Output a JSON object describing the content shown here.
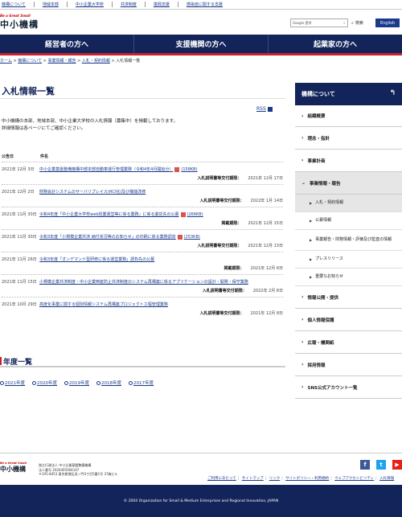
{
  "top_links": [
    "機構について",
    "地域本部",
    "中小企業大学校",
    "共済制度",
    "復興支援",
    "感染症に関する支援"
  ],
  "header": {
    "logo_tag": "Be a Great Small",
    "logo_name": "中小機構",
    "search_label": "Google 提供",
    "search_button": "検索",
    "lang_button": "English"
  },
  "nav": [
    "経営者の方へ",
    "支援機関の方へ",
    "起業家の方へ"
  ],
  "breadcrumb": [
    "ホーム",
    "機構について",
    "事業情報・報告",
    "入札・契約情報",
    "入札情報一覧"
  ],
  "page_title": "入札情報一覧",
  "rss_label": "RSS",
  "intro": [
    "中小機構の本部、地域本部、中小企業大学校の入札情報（募集中）を掲載しております。",
    "詳細情報は各ページにてご確認ください。"
  ],
  "table_head": {
    "date": "公告日",
    "title": "件名"
  },
  "rows": [
    {
      "date": "2021年 12月 3日",
      "title": "中小企業基盤整備機構中部本部自動車運行管理業務（令和4年4月開始分）",
      "size": "(158KB)",
      "meta_label": "入札説明書等交付期限：",
      "meta_date": "2021年 12月 17日"
    },
    {
      "date": "2021年 12月 2日",
      "title": "財務会計システムのサーバリプレイス(HCI化)及び機能改修",
      "size": "",
      "meta_label": "入札説明書等交付期限：",
      "meta_date": "2022年 1月 14日"
    },
    {
      "date": "2021年 11月 30日",
      "title": "令和4年度「中小企業大学校web授業運営等に係る業務」に係る委託先の公募",
      "size": "(266KB)",
      "meta_label": "掲載期限：",
      "meta_date": "2021年 12月 15日"
    },
    {
      "date": "2021年 11月 30日",
      "title": "令和3年度「小規模企業共済 納付状況等のお知らせ」の印刷に係る業務調達",
      "size": "(253KB)",
      "meta_label": "入札説明書等交付期限：",
      "meta_date": "2021年 12月 13日"
    },
    {
      "date": "2021年 11月 26日",
      "title": "令和3年度「オンデマンド型研修に係る運営業務」請負先の公募",
      "size": "",
      "meta_label": "掲載期限：",
      "meta_date": "2021年 12月 6日"
    },
    {
      "date": "2021年 11月 15日",
      "title": "小規模企業共済制度・中小企業倒産防止共済制度のシステム再構築に係るアプリケーションの設計・開発・保守業務",
      "size": "",
      "meta_label": "入札説明書等交付期限：",
      "meta_date": "2022年 2月 8日"
    },
    {
      "date": "2021年 10月 29日",
      "title": "高度化事業に関する個別情報システム再構築プロジェクト工程管理業務",
      "size": "",
      "meta_label": "入札説明書等交付期限：",
      "meta_date": "2021年 12月 8日"
    }
  ],
  "year_heading": "年度一覧",
  "years": [
    "2021年度",
    "2020年度",
    "2019年度",
    "2018年度",
    "2017年度"
  ],
  "sidebar": {
    "head": "機構について",
    "items": [
      "組織概要",
      "理念・指針",
      "事業計画",
      "事業情報・報告"
    ],
    "subitems": [
      "入札・契約情報",
      "公募情報",
      "事業報告・財務情報・評価及び監査の情報",
      "プレスリリース",
      "重要なお知らせ"
    ],
    "items2": [
      "情報公開・提供",
      "個人情報保護",
      "広報・機関紙",
      "採用情報",
      "SNS公式アカウント一覧"
    ]
  },
  "footer": {
    "logo_tag": "Be a Great Small",
    "logo_name": "中小機構",
    "addr1": "独立行政法人 中小企業基盤整備機構",
    "addr2": "法人番号 2020405004147",
    "addr3": "〒105-8453 東京都港区虎ノ門3丁目5番1号 37森ビル",
    "links": [
      "ご利用にあたって",
      "サイトマップ",
      "リンク",
      "サイトポリシー・利用規約",
      "ウェブアクセシビリティ",
      "入札情報"
    ],
    "copyright": "© 2004 Organization for Small & Medium Enterprises and Regional Innovation, JAPAN"
  },
  "colors": {
    "navy": "#13245a",
    "accent_red": "#c7222c",
    "link": "#1a3b8c"
  }
}
